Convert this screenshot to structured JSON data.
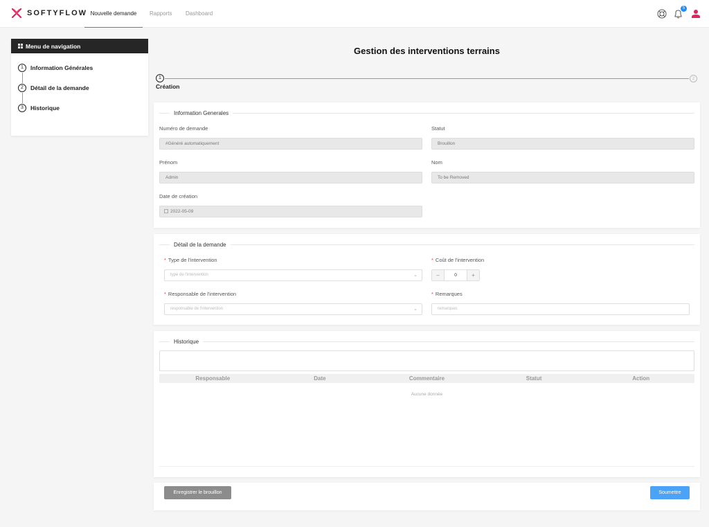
{
  "header": {
    "logo_text": "SOFTYFLOW",
    "brand_color": "#e0245e",
    "tabs": [
      {
        "label": "Nouvelle demande",
        "active": true
      },
      {
        "label": "Rapports",
        "active": false
      },
      {
        "label": "Dashboard",
        "active": false
      }
    ],
    "notification_count": "5",
    "accent": "#1890ff",
    "icons": [
      "lifebuoy-icon",
      "bell-icon",
      "user-icon"
    ]
  },
  "sidebar": {
    "title": "Menu de navigation",
    "items": [
      {
        "num": "1",
        "label": "Information Générales"
      },
      {
        "num": "2",
        "label": "Détail de la demande"
      },
      {
        "num": "3",
        "label": "Historique"
      }
    ]
  },
  "main": {
    "title": "Gestion des interventions terrains",
    "steps": [
      {
        "num": "1",
        "label": "Création"
      },
      {
        "num": "2",
        "label": ""
      }
    ]
  },
  "info": {
    "legend": "Information Generales",
    "numero_label": "Numéro de demande",
    "numero_value": "#Généré automatiquement",
    "statut_label": "Statut",
    "statut_value": "Brouillon",
    "prenom_label": "Prénom",
    "prenom_value": "Admin",
    "nom_label": "Nom",
    "nom_value": "To be Removed",
    "date_label": "Date de création",
    "date_value": "2022-05-09"
  },
  "detail": {
    "legend": "Détail de la demande",
    "type_label": "Type de l'intervention",
    "type_placeholder": "type de l'intervention",
    "cout_label": "Coût de l'intervention",
    "cout_value": "0",
    "resp_label": "Responsable de l'intervention",
    "resp_placeholder": "responsable de l'intervention",
    "remarques_label": "Remarques",
    "remarques_placeholder": "remarques"
  },
  "historique": {
    "legend": "Historique",
    "columns": [
      "Responsable",
      "Date",
      "Commentaire",
      "Statut",
      "Action"
    ],
    "empty_text": "Aucune donnée"
  },
  "footer": {
    "draft_label": "Enregistrer le brouillon",
    "submit_label": "Soumettre"
  }
}
